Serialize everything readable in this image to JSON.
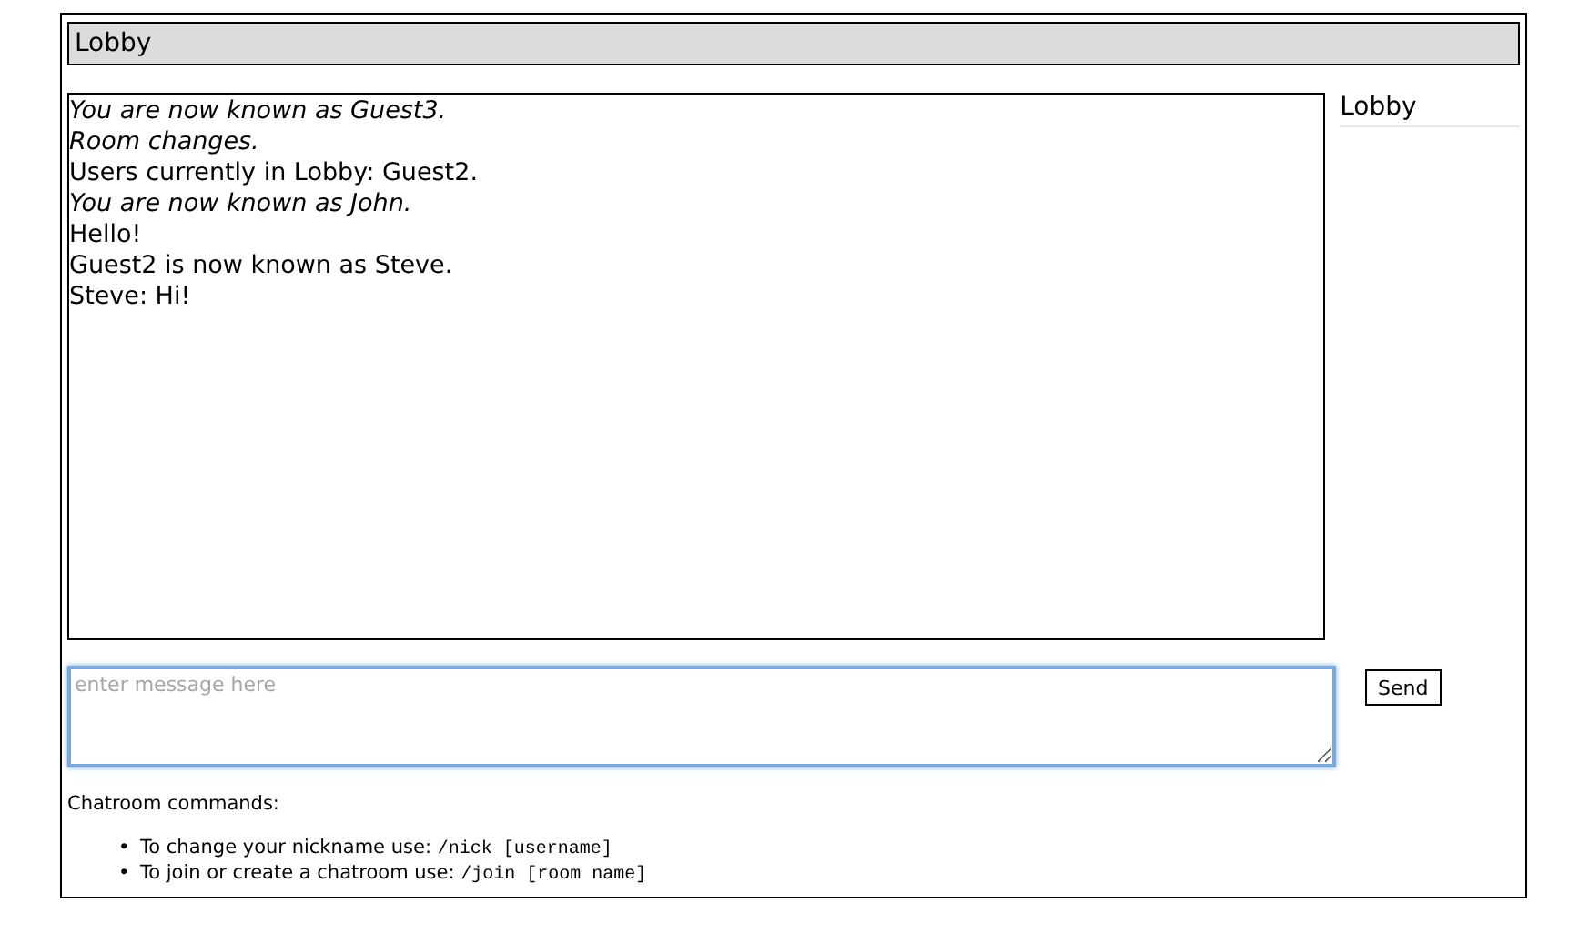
{
  "room_title": "Lobby",
  "messages": [
    {
      "kind": "system",
      "text": "You are now known as Guest3."
    },
    {
      "kind": "system",
      "text": "Room changes."
    },
    {
      "kind": "plain",
      "text": "Users currently in Lobby: Guest2."
    },
    {
      "kind": "system",
      "text": "You are now known as John."
    },
    {
      "kind": "plain",
      "text": "Hello!"
    },
    {
      "kind": "plain",
      "text": "Guest2 is now known as Steve."
    },
    {
      "kind": "plain",
      "text": "Steve: Hi!"
    }
  ],
  "room_list": [
    {
      "name": "Lobby"
    }
  ],
  "message_input": {
    "placeholder": "enter message here",
    "focused": true
  },
  "send_button": "Send",
  "help": {
    "title": "Chatroom commands:",
    "items": [
      {
        "bullet": "•",
        "text": "To change your nickname use:",
        "command": "/nick [username]"
      },
      {
        "bullet": "•",
        "text": "To join or create a chatroom use:",
        "command": "/join [room name]"
      }
    ]
  }
}
